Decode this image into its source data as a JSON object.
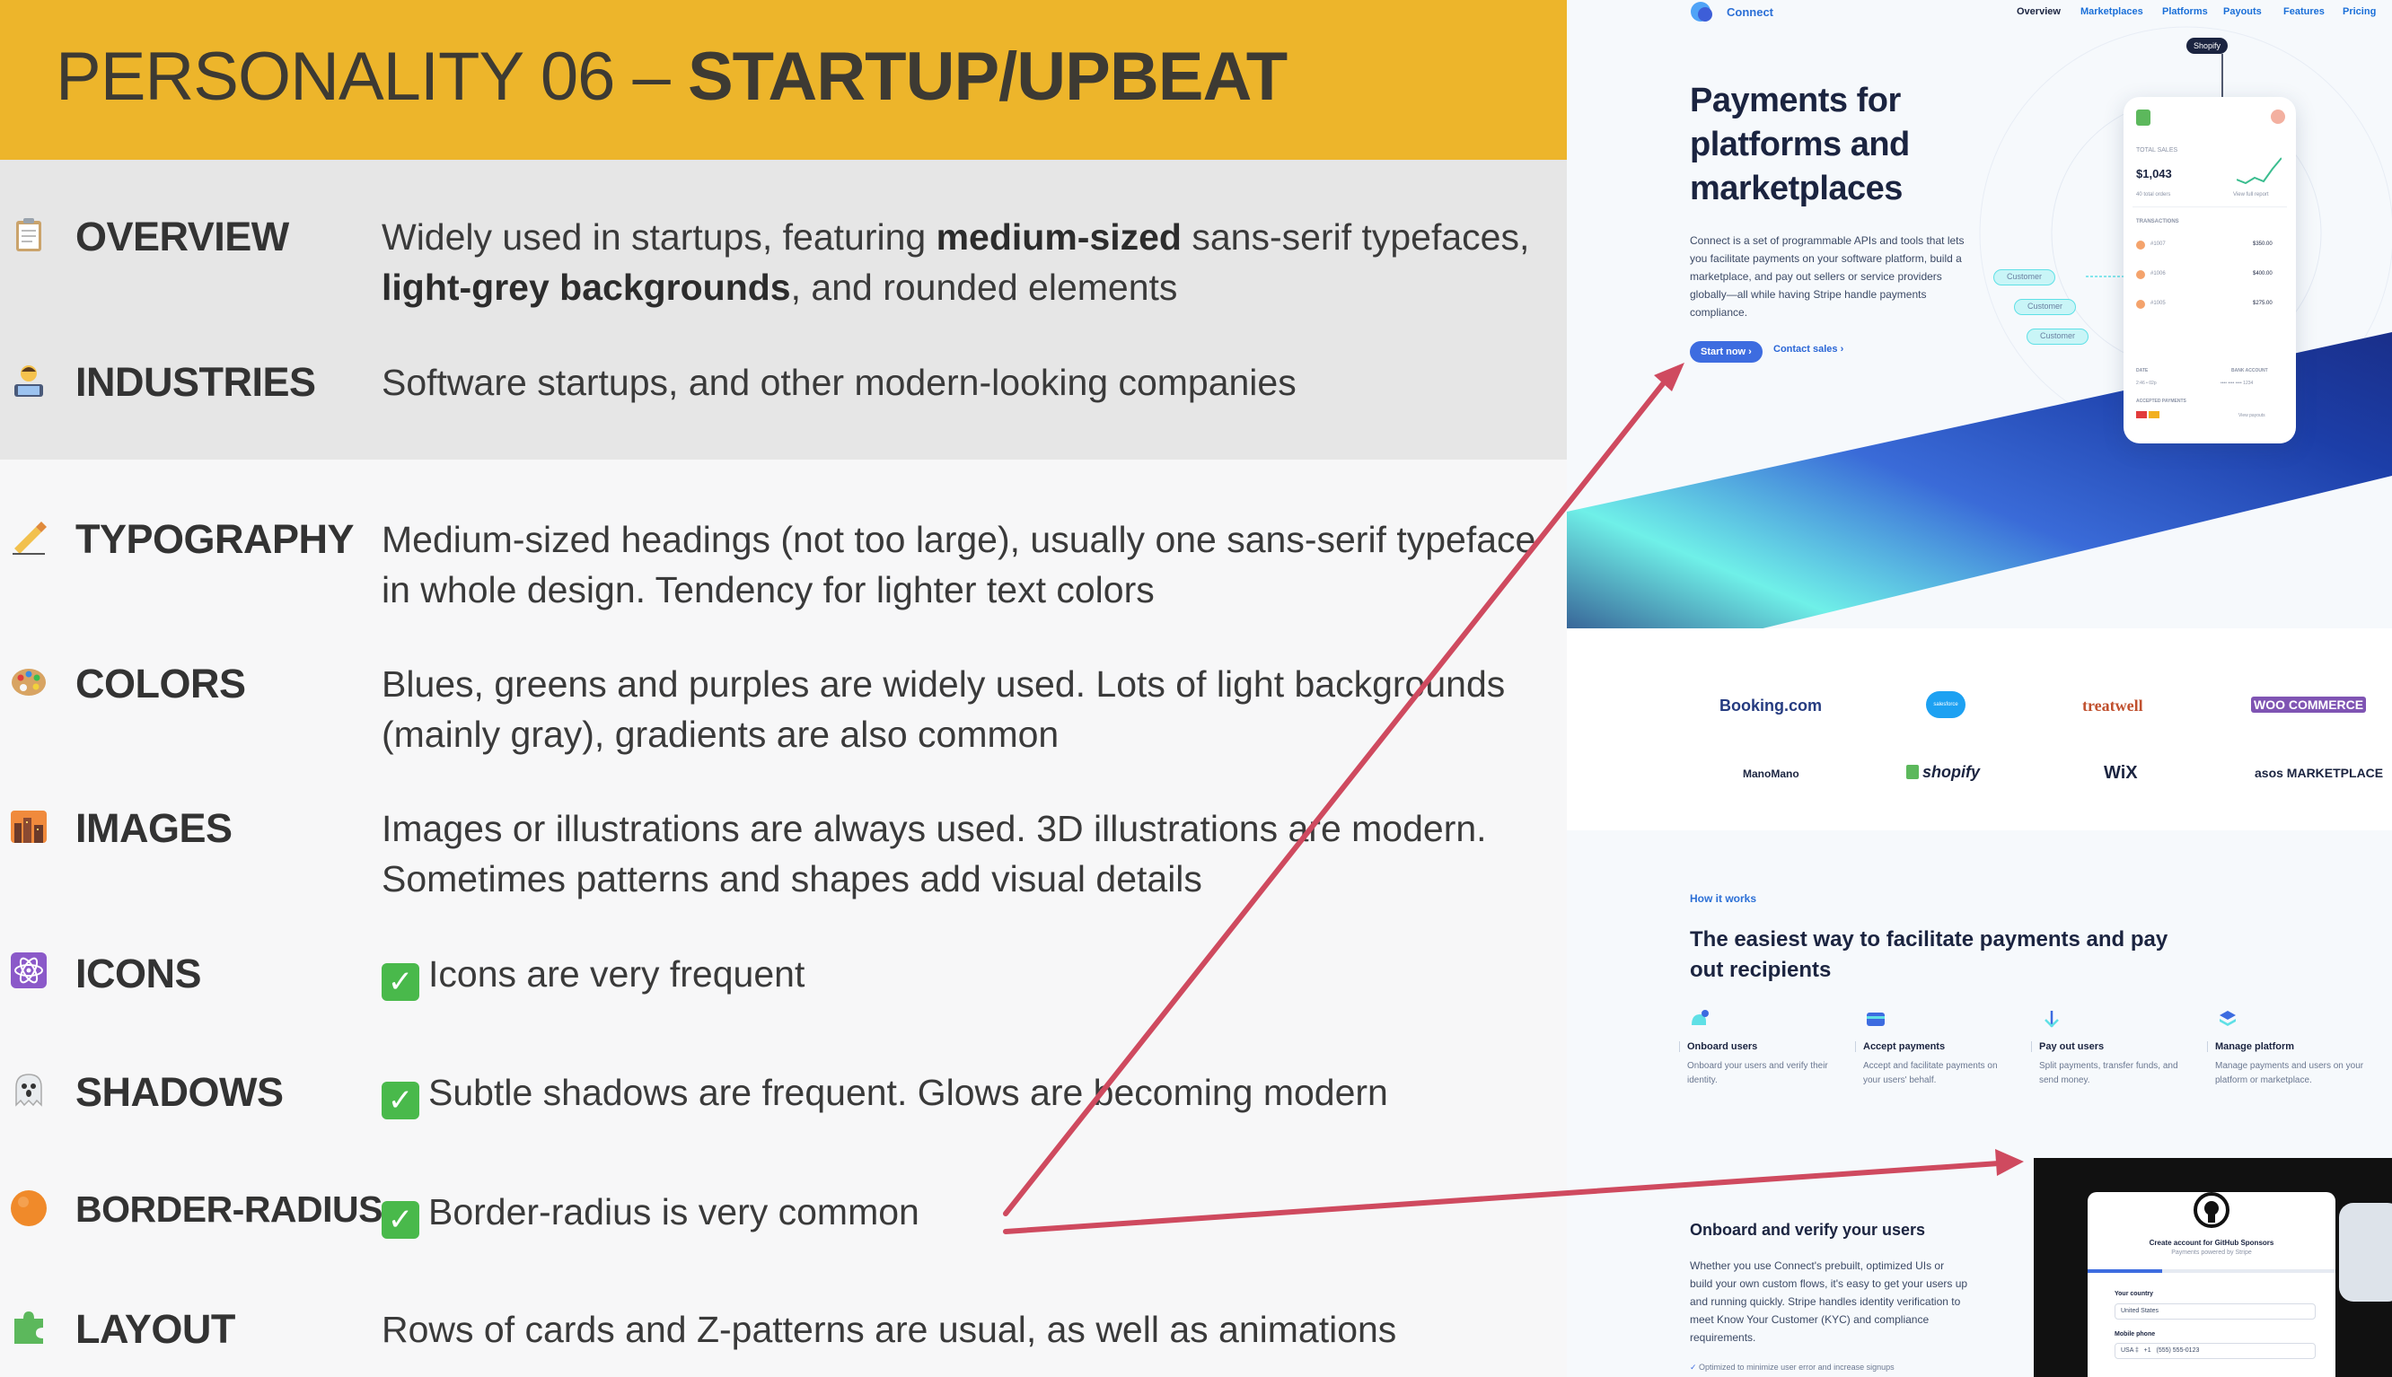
{
  "slide": {
    "title_light": "PERSONALITY 06 – ",
    "title_bold": "STARTUP/UPBEAT",
    "rows": [
      {
        "icon": "clipboard-icon",
        "label": "OVERVIEW",
        "text_parts": [
          "Widely used in startups, featuring ",
          "medium-sized",
          " sans-serif typefaces, ",
          "light-grey backgrounds",
          ", and rounded elements"
        ]
      },
      {
        "icon": "technologist-icon",
        "label": "INDUSTRIES",
        "text": "Software startups, and other modern-looking companies"
      },
      {
        "icon": "writing-hand-icon",
        "label": "TYPOGRAPHY",
        "text": "Medium-sized headings (not too large), usually one sans-serif typeface in whole design. Tendency for lighter text colors"
      },
      {
        "icon": "palette-icon",
        "label": "COLORS",
        "text": "Blues, greens and purples are widely used. Lots of light backgrounds (mainly gray), gradients are also common"
      },
      {
        "icon": "city-sunset-icon",
        "label": "IMAGES",
        "text": "Images or illustrations are always used. 3D illustrations are modern. Sometimes patterns and shapes add visual details"
      },
      {
        "icon": "atom-icon",
        "label": "ICONS",
        "text": "Icons are very frequent"
      },
      {
        "icon": "ghost-icon",
        "label": "SHADOWS",
        "text": "Subtle shadows are frequent. Glows are becoming modern"
      },
      {
        "icon": "orange-circle-icon",
        "label": "BORDER-RADIUS",
        "text": "Border-radius is very common"
      },
      {
        "icon": "puzzle-piece-icon",
        "label": "LAYOUT",
        "text": "Rows of cards and Z-patterns are usual, as well as animations"
      }
    ]
  },
  "site": {
    "brand": "Connect",
    "nav": [
      "Overview",
      "Marketplaces",
      "Platforms",
      "Payouts",
      "Features",
      "Pricing"
    ],
    "hero_title": "Payments for platforms and marketplaces",
    "hero_body": "Connect is a set of programmable APIs and tools that lets you facilitate payments on your software platform, build a marketplace, and pay out sellers or service providers globally—all while having Stripe handle payments compliance.",
    "cta_primary": "Start now ›",
    "cta_secondary": "Contact sales ›",
    "phone": {
      "tag": "Shopify",
      "total_sales_label": "TOTAL SALES",
      "total_sales": "$1,043",
      "total_orders": "40 total orders",
      "view_report": "View full report",
      "transactions_label": "TRANSACTIONS",
      "transactions": [
        {
          "id": "#1007",
          "amount": "$350.00"
        },
        {
          "id": "#1006",
          "amount": "$400.00"
        },
        {
          "id": "#1005",
          "amount": "$275.00"
        }
      ],
      "date_label": "DATE",
      "date_value": "2:46 • 02p",
      "bank_label": "BANK ACCOUNT",
      "bank_value": "•••• •••• •••• 1234",
      "accepted_label": "ACCEPTED PAYMENTS",
      "view_payouts": "View payouts"
    },
    "customer_tag": "Customer",
    "brands": [
      "Booking.com",
      "salesforce",
      "treatwell",
      "WOO COMMERCE",
      "ManoMano",
      "shopify",
      "WiX",
      "asos MARKETPLACE"
    ],
    "how": {
      "eyebrow": "How it works",
      "title": "The easiest way to facilitate payments and pay out recipients",
      "steps": [
        {
          "title": "Onboard users",
          "desc": "Onboard your users and verify their identity."
        },
        {
          "title": "Accept payments",
          "desc": "Accept and facilitate payments on your users' behalf."
        },
        {
          "title": "Pay out users",
          "desc": "Split payments, transfer funds, and send money."
        },
        {
          "title": "Manage platform",
          "desc": "Manage payments and users on your platform or marketplace."
        }
      ]
    },
    "onboard": {
      "title": "Onboard and verify your users",
      "body": "Whether you use Connect's prebuilt, optimized UIs or build your own custom flows, it's easy to get your users up and running quickly. Stripe handles identity verification to meet Know Your Customer (KYC) and compliance requirements.",
      "bullet": "Optimized to minimize user error and increase signups"
    },
    "github_card": {
      "title": "Create account for GitHub Sponsors",
      "subtitle": "Payments powered by Stripe",
      "country_label": "Your country",
      "country_value": "United States",
      "phone_label": "Mobile phone",
      "phone_value": "USA ‡   +1   (555) 555-0123"
    }
  },
  "colors": {
    "header_bg": "#edb52b",
    "band_bg": "#e6e6e6",
    "arrow": "#cf4a5f",
    "accent_blue": "#3d6ce0",
    "cyan": "#5fe0e6"
  }
}
